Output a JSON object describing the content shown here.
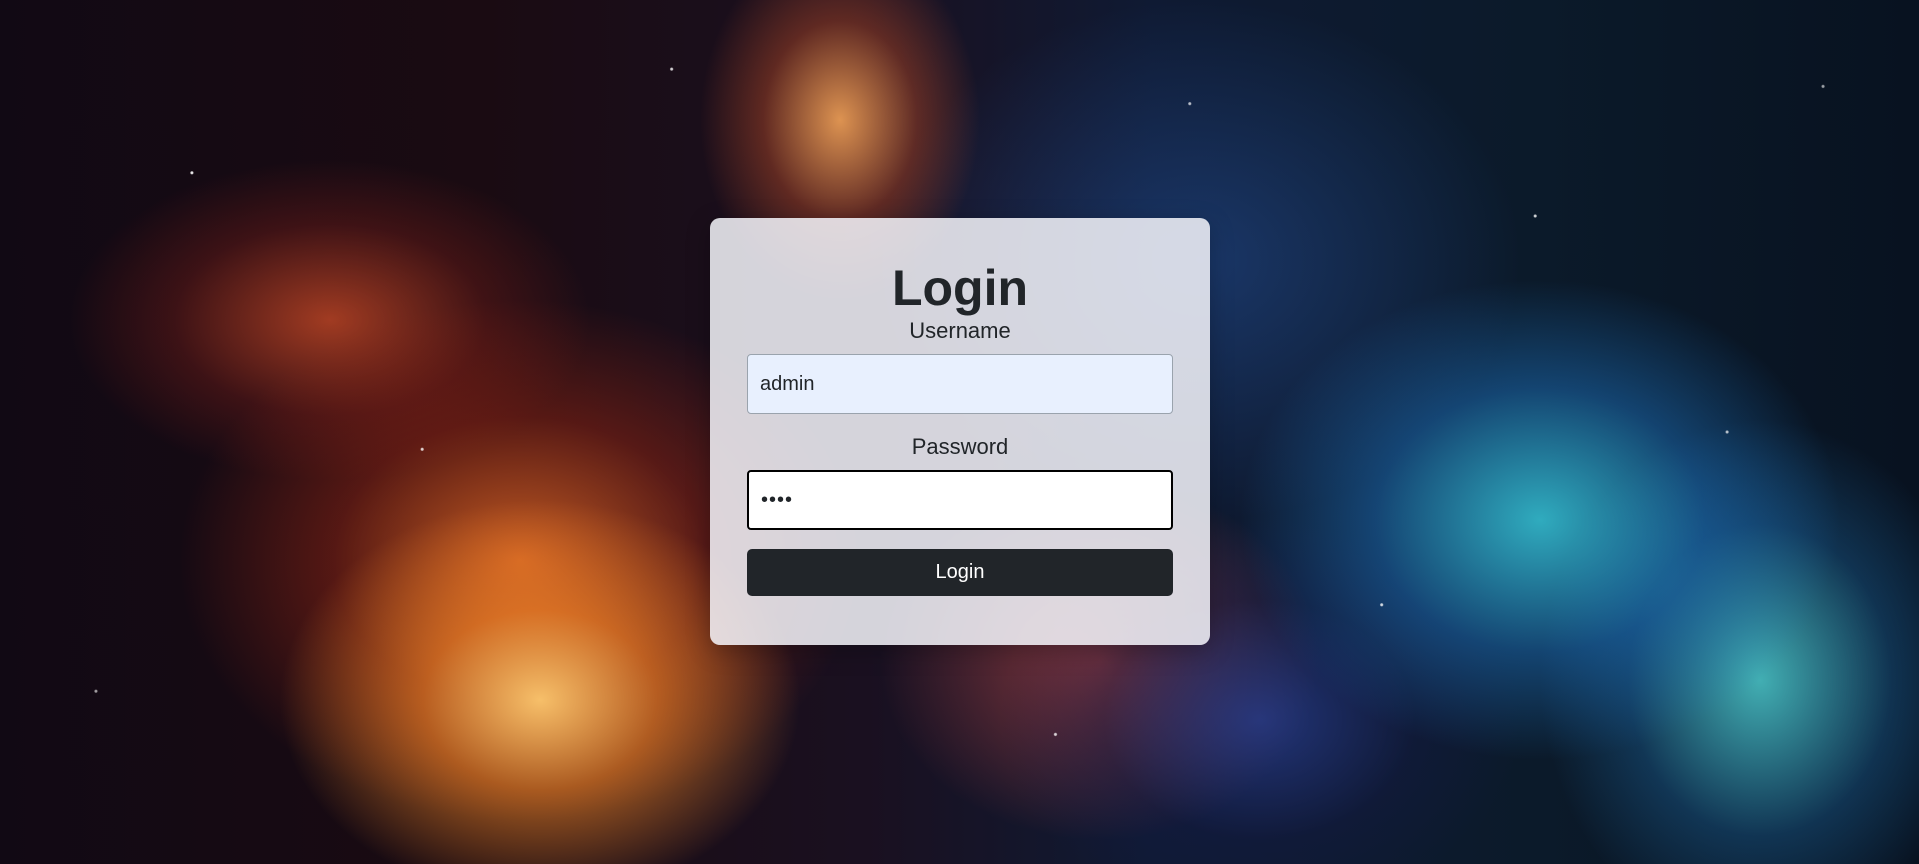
{
  "login": {
    "title": "Login",
    "username_label": "Username",
    "username_value": "admin",
    "password_label": "Password",
    "password_value": "1234",
    "submit_label": "Login"
  },
  "colors": {
    "card_background": "#f5f5fa",
    "button_background": "#212529",
    "button_text": "#ffffff",
    "username_field_background": "#e8f0fe",
    "text": "#212529"
  }
}
